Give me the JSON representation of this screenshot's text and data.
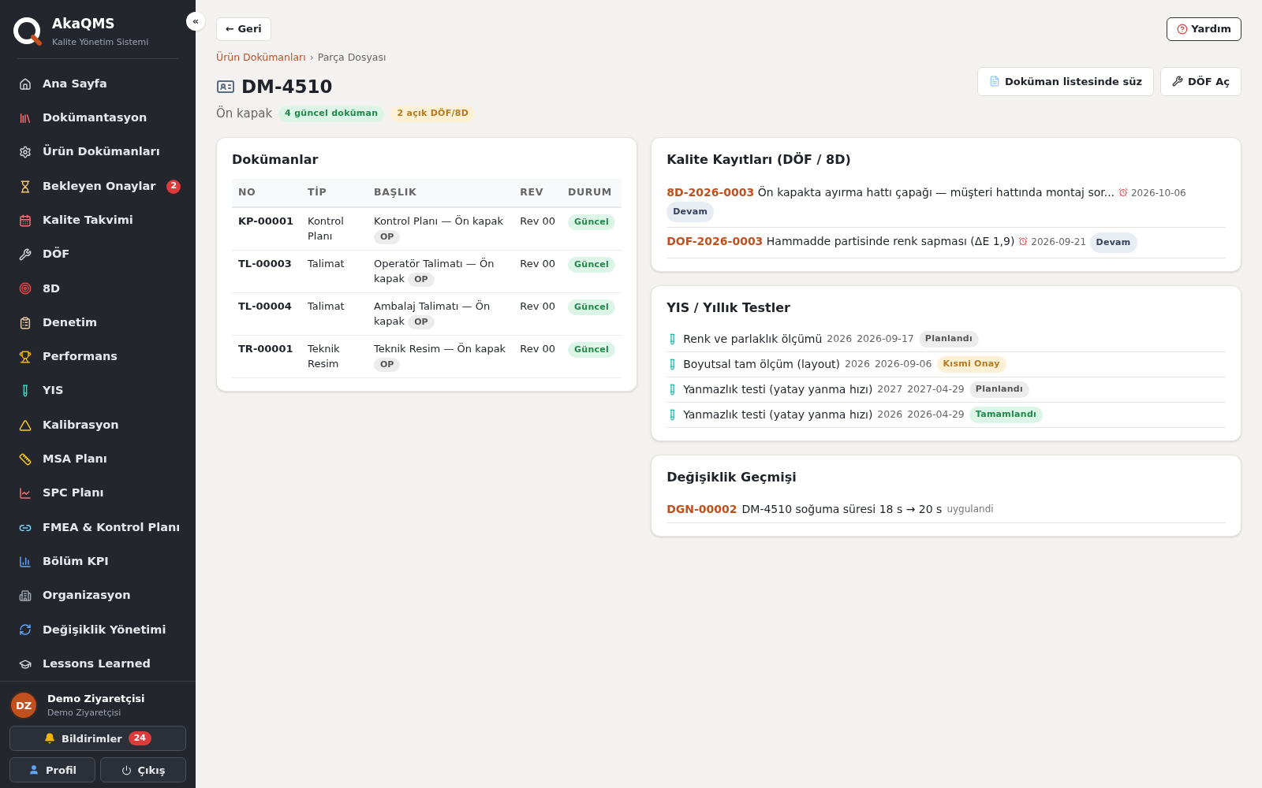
{
  "app": {
    "name": "AkaQMS",
    "subtitle": "Kalite Yönetim Sistemi",
    "collapse": "«"
  },
  "sidebar": {
    "items": [
      {
        "label": "Ana Sayfa"
      },
      {
        "label": "Dokümantasyon"
      },
      {
        "label": "Ürün Dokümanları"
      },
      {
        "label": "Bekleyen Onaylar",
        "badge": "2"
      },
      {
        "label": "Kalite Takvimi"
      },
      {
        "label": "DÖF"
      },
      {
        "label": "8D"
      },
      {
        "label": "Denetim"
      },
      {
        "label": "Performans"
      },
      {
        "label": "YIS"
      },
      {
        "label": "Kalibrasyon"
      },
      {
        "label": "MSA Planı"
      },
      {
        "label": "SPC Planı"
      },
      {
        "label": "FMEA & Kontrol Planı"
      },
      {
        "label": "Bölüm KPI"
      },
      {
        "label": "Organizasyon"
      },
      {
        "label": "Değişiklik Yönetimi"
      },
      {
        "label": "Lessons Learned"
      }
    ]
  },
  "user": {
    "initials": "DZ",
    "name": "Demo Ziyaretçisi",
    "role": "Demo Ziyaretçisi"
  },
  "notifications": {
    "label": "Bildirimler",
    "count": "24"
  },
  "profile_button": "Profil",
  "logout_button": "Çıkış",
  "back_button": "← Geri",
  "help_button": "Yardım",
  "breadcrumb": [
    {
      "label": "Ürün Dokümanları",
      "kind": "link"
    },
    {
      "label": "Parça Dosyası",
      "kind": "current"
    }
  ],
  "breadcrumb_separator": "›",
  "title": "DM-4510",
  "part_name": "Ön kapak",
  "badges": [
    {
      "label": "4 güncel doküman",
      "kind": "success"
    },
    {
      "label": "2 açık DÖF/8D",
      "kind": "warning"
    }
  ],
  "actions": [
    "Doküman listesinde süz",
    "DÖF Aç"
  ],
  "documents": {
    "title": "Dokümanlar",
    "columns": [
      "NO",
      "TİP",
      "BAŞLIK",
      "REV",
      "DURUM"
    ],
    "rows": [
      {
        "no": "KP-00001",
        "type": "Kontrol Planı",
        "title": "Kontrol Planı — Ön kapak",
        "tag": "OP",
        "rev": "Rev 00",
        "status": "Güncel"
      },
      {
        "no": "TL-00003",
        "type": "Talimat",
        "title": "Operatör Talimatı — Ön kapak",
        "tag": "OP",
        "rev": "Rev 00",
        "status": "Güncel"
      },
      {
        "no": "TL-00004",
        "type": "Talimat",
        "title": "Ambalaj Talimatı — Ön kapak",
        "tag": "OP",
        "rev": "Rev 00",
        "status": "Güncel"
      },
      {
        "no": "TR-00001",
        "type": "Teknik Resim",
        "title": "Teknik Resim — Ön kapak",
        "tag": "OP",
        "rev": "Rev 00",
        "status": "Güncel"
      }
    ]
  },
  "quality_records": {
    "title": "Kalite Kayıtları (DÖF / 8D)",
    "items": [
      {
        "code": "8D-2026-0003",
        "text": "Ön kapakta ayırma hattı çapağı — müşteri hattında montaj sor...",
        "due": "2026-10-06",
        "status": "Devam"
      },
      {
        "code": "DOF-2026-0003",
        "text": "Hammadde partisinde renk sapması (ΔE 1,9)",
        "due": "2026-09-21",
        "status": "Devam"
      }
    ]
  },
  "tests": {
    "title": "YIS / Yıllık Testler",
    "items": [
      {
        "name": "Renk ve parlaklık ölçümü",
        "year": "2026",
        "date": "2026-09-17",
        "status": "Planlandı",
        "kind": "planned"
      },
      {
        "name": "Boyutsal tam ölçüm (layout)",
        "year": "2026",
        "date": "2026-09-06",
        "status": "Kısmi Onay",
        "kind": "partial"
      },
      {
        "name": "Yanmazlık testi (yatay yanma hızı)",
        "year": "2027",
        "date": "2027-04-29",
        "status": "Planlandı",
        "kind": "planned"
      },
      {
        "name": "Yanmazlık testi (yatay yanma hızı)",
        "year": "2026",
        "date": "2026-04-29",
        "status": "Tamamlandı",
        "kind": "done"
      }
    ]
  },
  "changes": {
    "title": "Değişiklik Geçmişi",
    "items": [
      {
        "code": "DGN-00002",
        "text": "DM-4510 soğuma süresi 18 s → 20 s",
        "state": "uygulandi"
      }
    ]
  }
}
